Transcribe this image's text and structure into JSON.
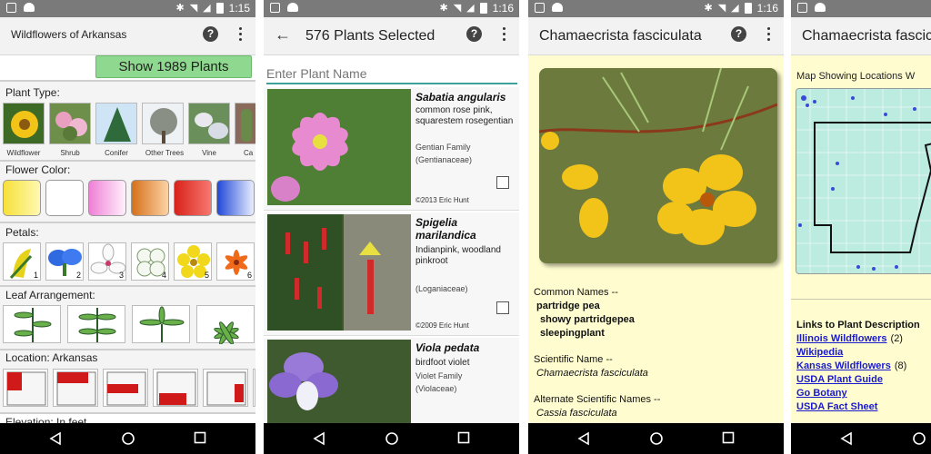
{
  "statusbar": {
    "time_1": "1:15",
    "time_2": "1:16",
    "time_3": "1:16",
    "time_4": "1:16"
  },
  "screen1": {
    "title": "Wildflowers of Arkansas",
    "show_button": "Show 1989 Plants",
    "plant_type_label": "Plant Type:",
    "plant_types": [
      "Wildflower",
      "Shrub",
      "Conifer",
      "Other Trees",
      "Vine",
      "Ca"
    ],
    "flower_color_label": "Flower Color:",
    "flower_colors": [
      "#f5e04a",
      "#ffffff",
      "#f08ad8",
      "#e0801e",
      "#e02a20",
      "#2a5ae0"
    ],
    "petals_label": "Petals:",
    "petal_numbers": [
      "1",
      "2",
      "3",
      "4",
      "5",
      "6"
    ],
    "leaf_label": "Leaf Arrangement:",
    "location_label": "Location: Arkansas",
    "elevation_label": "Elevation: In feet"
  },
  "screen2": {
    "title": "576 Plants Selected",
    "search_placeholder": "Enter Plant Name",
    "plants": [
      {
        "name": "Sabatia angularis",
        "common": "common rose pink, squarestem rosegentian",
        "family_1": "Gentian Family",
        "family_2": "(Gentianaceae)",
        "copyright": "©2013 Eric Hunt"
      },
      {
        "name": "Spigelia marilandica",
        "common": "Indianpink, woodland pinkroot",
        "family_1": "",
        "family_2": "(Loganiaceae)",
        "copyright": "©2009 Eric Hunt"
      },
      {
        "name": "Viola pedata",
        "common": "birdfoot violet",
        "family_1": "Violet Family",
        "family_2": "(Violaceae)",
        "copyright": ""
      }
    ]
  },
  "screen3": {
    "title": "Chamaecrista fasciculata",
    "common_names_label": "Common Names --",
    "common_names": [
      "partridge pea",
      "showy partridgepea",
      "sleepingplant"
    ],
    "scientific_label": "Scientific Name --",
    "scientific_name": "Chamaecrista fasciculata",
    "alt_label": "Alternate Scientific Names --",
    "alt_name": "Cassia fasciculata"
  },
  "screen4": {
    "title": "Chamaecrista fascic",
    "map_caption": "Map Showing Locations W",
    "links_title": "Links to Plant Description",
    "links": [
      {
        "label": "Illinois Wildflowers",
        "count": "(2)"
      },
      {
        "label": "Wikipedia",
        "count": ""
      },
      {
        "label": "Kansas Wildflowers",
        "count": "(8)"
      },
      {
        "label": "USDA Plant Guide",
        "count": ""
      },
      {
        "label": "Go Botany",
        "count": ""
      },
      {
        "label": "USDA Fact Sheet",
        "count": ""
      }
    ]
  },
  "colors": {
    "accent": "#3aa19a",
    "show_button": "#8fd88f",
    "detail_bg": "#fffdd0",
    "link": "#1a1acc"
  }
}
